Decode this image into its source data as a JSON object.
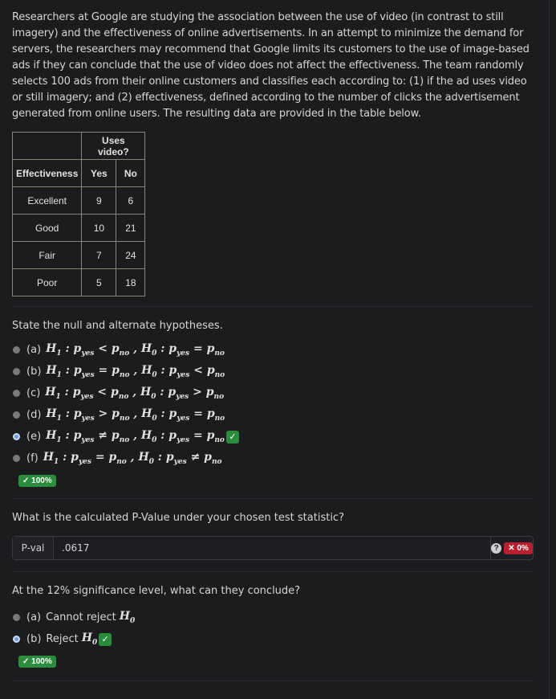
{
  "intro": "Researchers at Google are studying the association between the use of video (in contrast to still imagery) and the effectiveness of online advertisements. In an attempt to minimize the demand for servers, the researchers may recommend that Google limits its customers to the use of image-based ads if they can conclude that the use of video does not affect the effectiveness. The team randomly selects 100 ads from their online customers and classifies each according to: (1) if the ad uses video or still imagery; and (2) effectiveness, defined according to the number of clicks the advertisement generated from online users. The resulting data are provided in the table below.",
  "table": {
    "group_header": "Uses video?",
    "row_header": "Effectiveness",
    "columns": [
      "Yes",
      "No"
    ],
    "rows": [
      {
        "label": "Excellent",
        "yes": "9",
        "no": "6"
      },
      {
        "label": "Good",
        "yes": "10",
        "no": "21"
      },
      {
        "label": "Fair",
        "yes": "7",
        "no": "24"
      },
      {
        "label": "Poor",
        "yes": "5",
        "no": "18"
      }
    ]
  },
  "q1": {
    "prompt": "State the null and alternate hypotheses.",
    "options": [
      {
        "letter": "(a)",
        "h1": "p_yes < p_no",
        "h0": "p_yes = p_no",
        "h1_op": "<",
        "h0_op": "="
      },
      {
        "letter": "(b)",
        "h1_op": "=",
        "h0_op": "<"
      },
      {
        "letter": "(c)",
        "h1_op": "<",
        "h0_op": ">"
      },
      {
        "letter": "(d)",
        "h1_op": ">",
        "h0_op": "="
      },
      {
        "letter": "(e)",
        "h1_op": "≠",
        "h0_op": "=",
        "selected": true,
        "correct": true
      },
      {
        "letter": "(f)",
        "h1_op": "=",
        "h0_op": "≠"
      }
    ],
    "score": "✓ 100%"
  },
  "q2": {
    "prompt": "What is the calculated P-Value under your chosen test statistic?",
    "label": "P-val",
    "value": ".0617",
    "help": "?",
    "score": "✕ 0%"
  },
  "q3": {
    "prompt": "At the 12% significance level, what can they conclude?",
    "options": [
      {
        "letter": "(a)",
        "text": "Cannot reject"
      },
      {
        "letter": "(b)",
        "text": "Reject",
        "selected": true,
        "correct": true
      }
    ],
    "score": "✓ 100%"
  },
  "math": {
    "H1": "H",
    "H0": "H",
    "p": "p",
    "yes": "yes",
    "no": "no",
    "sub1": "1",
    "sub0": "0"
  }
}
